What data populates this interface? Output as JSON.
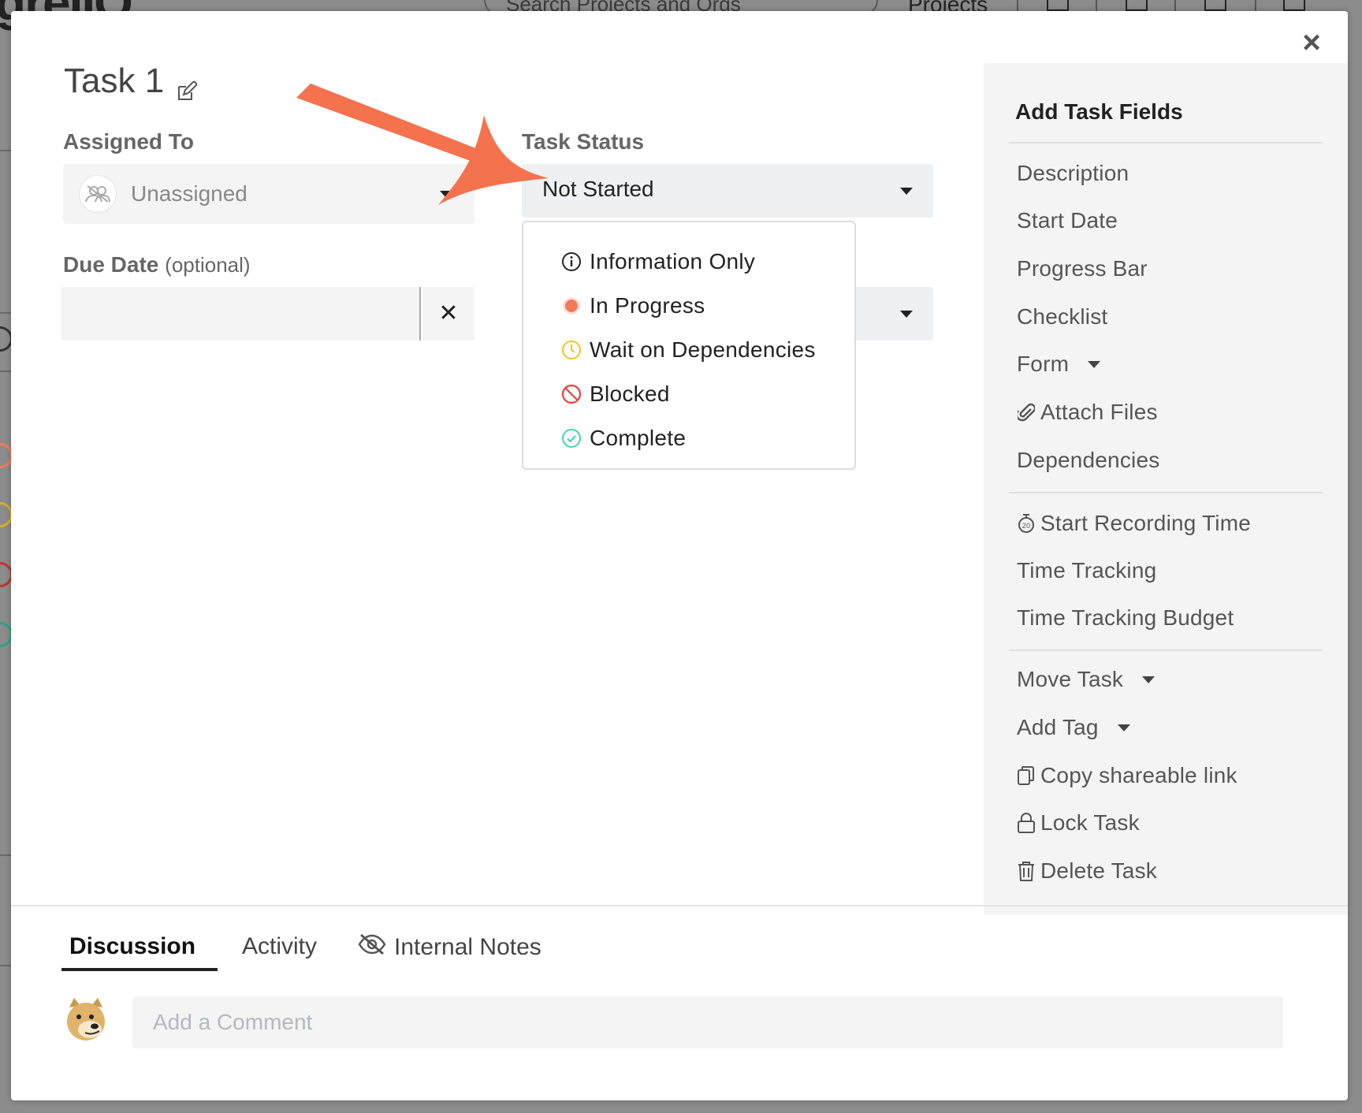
{
  "background": {
    "logo_text": "greIIO",
    "search_placeholder": "Search Projects and Orgs",
    "nav_projects": "Projects"
  },
  "task": {
    "title": "Task 1"
  },
  "fields": {
    "assigned_to_label": "Assigned To",
    "assignee_value": "Unassigned",
    "task_status_label": "Task Status",
    "task_status_value": "Not Started",
    "due_date_label": "Due Date",
    "due_date_optional": "(optional)",
    "due_date_value": "",
    "due_date_clear": "✕"
  },
  "status_options": [
    {
      "label": "Information Only",
      "icon": "info-icon",
      "color": "#222222"
    },
    {
      "label": "In Progress",
      "icon": "in-progress-dot-icon",
      "color": "#f4795b"
    },
    {
      "label": "Wait on Dependencies",
      "icon": "clock-icon",
      "color": "#f5c518"
    },
    {
      "label": "Blocked",
      "icon": "blocked-icon",
      "color": "#e8403a"
    },
    {
      "label": "Complete",
      "icon": "check-circle-icon",
      "color": "#3ed6b8"
    }
  ],
  "side_panel": {
    "title": "Add Task Fields",
    "items": [
      {
        "label": "Description"
      },
      {
        "label": "Start Date"
      },
      {
        "label": "Progress Bar"
      },
      {
        "label": "Checklist"
      },
      {
        "label": "Form",
        "icon": "caret-down-icon"
      },
      {
        "label": "Attach Files",
        "icon": "paperclip-icon"
      },
      {
        "label": "Dependencies"
      },
      {
        "label": "Start Recording Time",
        "icon": "stopwatch-icon"
      },
      {
        "label": "Time Tracking"
      },
      {
        "label": "Time Tracking Budget"
      },
      {
        "label": "Move Task",
        "icon": "caret-down-icon"
      },
      {
        "label": "Add Tag",
        "icon": "caret-down-icon"
      },
      {
        "label": "Copy shareable link",
        "icon": "copy-icon"
      },
      {
        "label": "Lock Task",
        "icon": "lock-icon"
      },
      {
        "label": "Delete Task",
        "icon": "trash-icon"
      }
    ]
  },
  "tabs": [
    {
      "label": "Discussion",
      "active": true
    },
    {
      "label": "Activity",
      "active": false
    },
    {
      "label": "Internal Notes",
      "active": false,
      "icon": "eye-slash-icon"
    }
  ],
  "comment": {
    "placeholder": "Add a Comment"
  },
  "colors": {
    "annotation_arrow": "#f4724e",
    "side_panel_bg": "#f4f4f5"
  }
}
